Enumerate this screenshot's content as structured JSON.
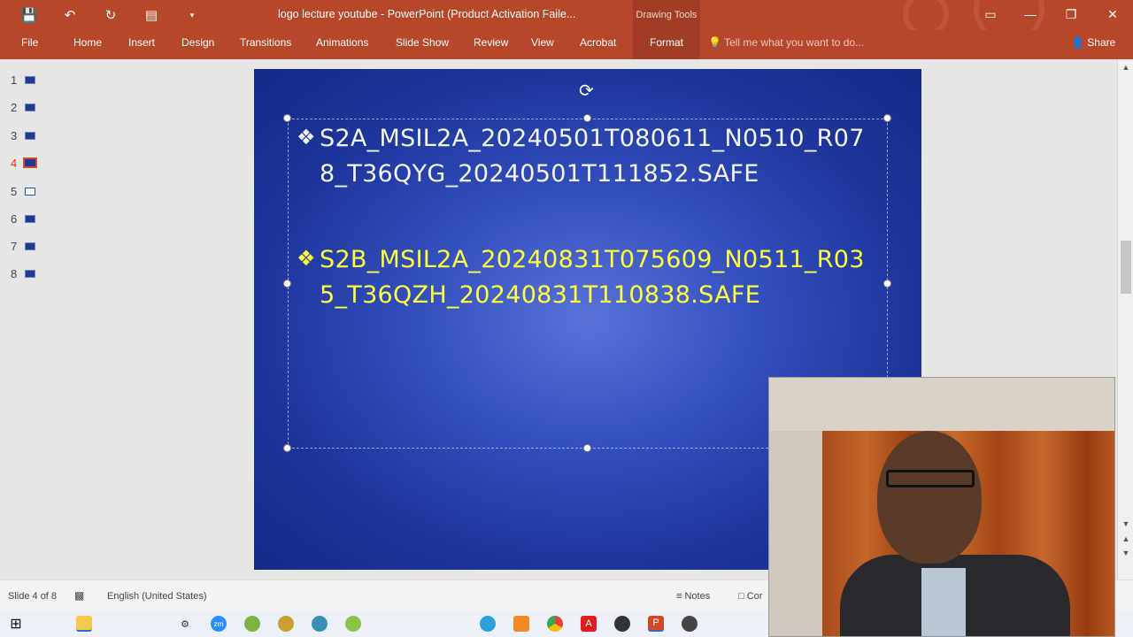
{
  "window": {
    "title": "logo lecture youtube - PowerPoint (Product Activation Faile...",
    "contextual_group": "Drawing Tools"
  },
  "ribbon": {
    "tabs": [
      "File",
      "Home",
      "Insert",
      "Design",
      "Transitions",
      "Animations",
      "Slide Show",
      "Review",
      "View",
      "Acrobat",
      "Format"
    ],
    "active_tab": "Format",
    "tell_me_placeholder": "Tell me what you want to do...",
    "share_label": "Share"
  },
  "thumbnails": {
    "numbers": [
      "1",
      "2",
      "3",
      "4",
      "5",
      "6",
      "7",
      "8"
    ],
    "active": "4"
  },
  "slide": {
    "bullets": [
      {
        "line1": "S2A_MSIL2A_20240501T080611_N0510_R07",
        "line2": "8_T36QYG_20240501T111852.SAFE",
        "color": "#f4f4f4"
      },
      {
        "line1": "S2B_MSIL2A_20240831T075609_N0511_R03",
        "line2": "5_T36QZH_20240831T110838.SAFE",
        "color": "#ffff3c"
      }
    ]
  },
  "statusbar": {
    "slide_info": "Slide 4 of 8",
    "language": "English (United States)",
    "notes_label": "Notes",
    "comments_label": "Cor"
  },
  "icons": {
    "qat": [
      "save-icon",
      "undo-icon",
      "redo-icon",
      "present-icon",
      "customize-icon"
    ],
    "taskbar": [
      "windows-start-icon",
      "file-explorer-icon",
      "settings-icon",
      "zoom-icon",
      "app-icon",
      "app-icon-2",
      "app-icon-3",
      "app-icon-4",
      "edge-icon",
      "app-icon-5",
      "chrome-icon",
      "acrobat-icon",
      "obs-icon",
      "powerpoint-icon",
      "app-icon-6"
    ]
  },
  "colors": {
    "accent": "#b7472a",
    "slide_background": "#2a44b0"
  }
}
